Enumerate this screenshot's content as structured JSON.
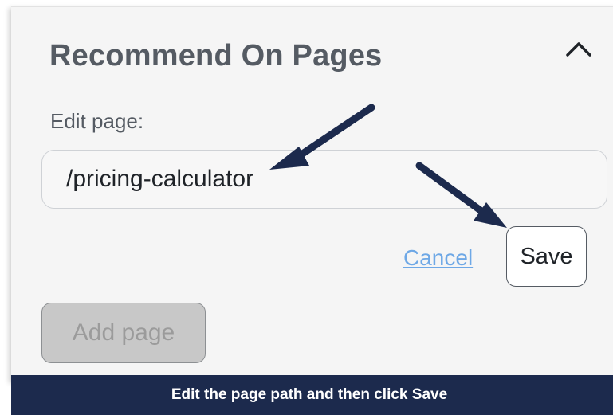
{
  "section": {
    "title": "Recommend On Pages",
    "collapse_icon": "chevron-up-icon"
  },
  "edit": {
    "label": "Edit page:",
    "input_value": "/pricing-calculator"
  },
  "actions": {
    "cancel_label": "Cancel",
    "save_label": "Save",
    "add_label": "Add page"
  },
  "caption": {
    "text": "Edit the page path and then click Save",
    "background_color": "#1c2a4d"
  },
  "annotation": {
    "arrow_color": "#1c2a4d",
    "arrow_icon": "arrow-annotation-icon"
  },
  "colors": {
    "panel_background": "#f5f5f5",
    "heading_text": "#555b63",
    "link": "#6ea8e6"
  }
}
